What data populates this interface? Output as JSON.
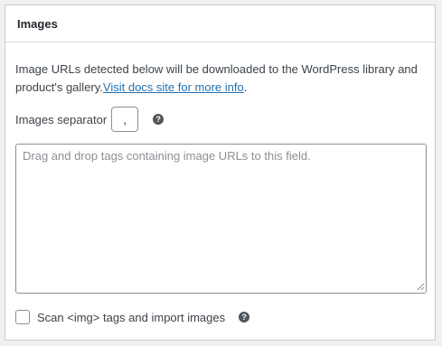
{
  "panel": {
    "title": "Images"
  },
  "description": {
    "text": "Image URLs detected below will be downloaded to the WordPress library and product's gallery.",
    "link_text": "Visit docs site for more info",
    "trailing": "."
  },
  "separator": {
    "label": "Images separator",
    "value": ",",
    "help_glyph": "?"
  },
  "dropzone": {
    "placeholder": "Drag and drop tags containing image URLs to this field.",
    "value": ""
  },
  "scan": {
    "label": "Scan <img> tags and import images",
    "checked": false,
    "help_glyph": "?"
  },
  "colors": {
    "link": "#2271b1",
    "help_icon": "#50575e",
    "border": "#8c8f94"
  },
  "icons": [
    "help-icon",
    "resize-grip-icon",
    "checkbox"
  ]
}
